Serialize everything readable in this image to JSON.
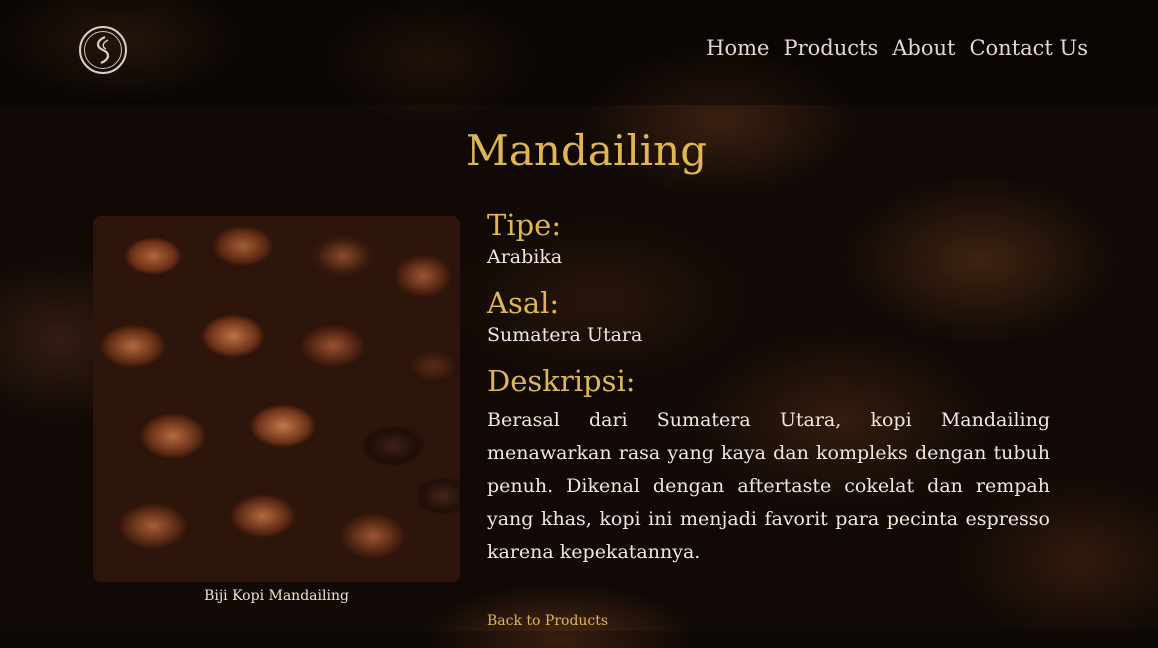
{
  "header": {
    "logo_icon": "coffee-bean-logo-icon",
    "nav": [
      {
        "label": "Home"
      },
      {
        "label": "Products"
      },
      {
        "label": "About"
      },
      {
        "label": "Contact Us"
      }
    ]
  },
  "product": {
    "name": "Mandailing",
    "image_caption": "Biji Kopi Mandailing",
    "type_label": "Tipe:",
    "type_value": "Arabika",
    "origin_label": "Asal:",
    "origin_value": "Sumatera Utara",
    "description_label": "Deskripsi:",
    "description": "Berasal dari Sumatera Utara, kopi Mandailing menawarkan rasa yang kaya dan kompleks dengan tubuh penuh. Dikenal dengan aftertaste cokelat dan rempah yang khas, kopi ini menjadi favorit para pecinta espresso karena kepekatannya.",
    "back_link": "Back to Products"
  },
  "colors": {
    "accent": "#e0b652",
    "text": "#f1e8dc",
    "nav_text": "#e3d8c9",
    "background": "#1e120b"
  }
}
